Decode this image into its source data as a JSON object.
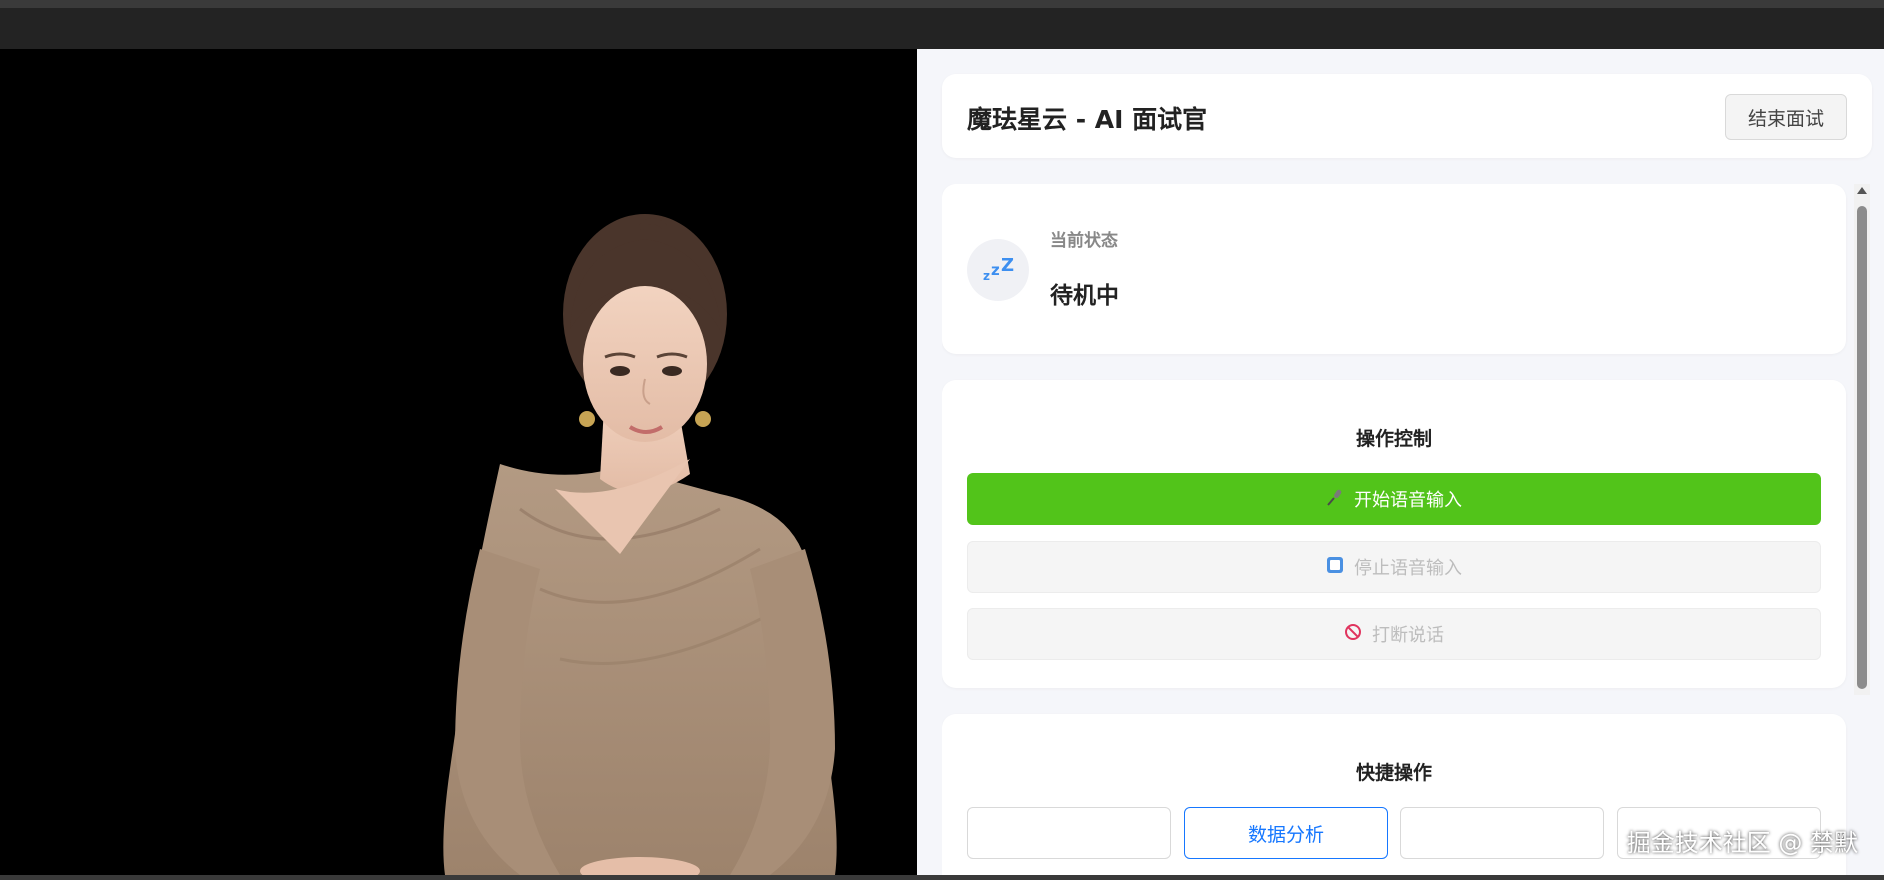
{
  "app": {
    "title": "魔珐星云 - AI 面试官",
    "end_button": "结束面试"
  },
  "status": {
    "label": "当前状态",
    "value": "待机中",
    "icon": "sleeping-zzz-icon"
  },
  "controls": {
    "title": "操作控制",
    "start_voice": "开始语音输入",
    "stop_voice": "停止语音输入",
    "interrupt": "打断说话",
    "start_icon": "microphone-icon",
    "stop_icon": "stop-square-icon",
    "interrupt_icon": "prohibited-icon"
  },
  "quick_actions": {
    "title": "快捷操作",
    "buttons": [
      "",
      "数据分析",
      "",
      ""
    ]
  },
  "watermark": "掘金技术社区 @ 禁默",
  "colors": {
    "primary_green": "#52c41a",
    "link_blue": "#1677ff",
    "panel_bg": "#f5f6fa"
  }
}
